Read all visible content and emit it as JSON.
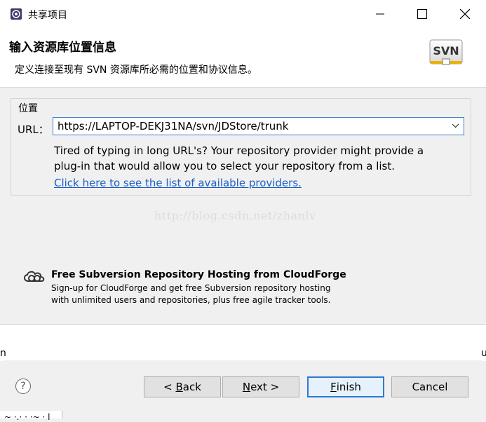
{
  "window": {
    "title": "共享项目"
  },
  "banner": {
    "title": "输入资源库位置信息",
    "description": "定义连接至现有 SVN 资源库所必需的位置和协议信息。",
    "logo_text": "SVN"
  },
  "location": {
    "group_title": "位置",
    "url_label": "URL：",
    "url_value": "https://LAPTOP-DEKJ31NA/svn/JDStore/trunk",
    "hint_line1": "Tired of typing in long URL's?  Your repository provider might provide a",
    "hint_line2": "plug-in that would allow you to select your repository from a list.",
    "providers_link": "Click here to see the list of available providers."
  },
  "watermark": "http://blog.csdn.net/zhanlv",
  "cloudforge": {
    "title": "Free Subversion Repository Hosting from CloudForge",
    "desc_line1": "Sign-up for CloudForge and get free Subversion repository hosting",
    "desc_line2": "with unlimited users and repositories, plus free agile tracker tools."
  },
  "background": {
    "left_char": "n",
    "right_char": "u",
    "bottom_text": "~ ·.· · ·~ · l"
  },
  "buttons": {
    "back_prefix": "< ",
    "back_mnemonic": "B",
    "back_rest": "ack",
    "next_mnemonic": "N",
    "next_rest": "ext >",
    "finish_mnemonic": "F",
    "finish_rest": "inish",
    "cancel": "Cancel"
  },
  "icons": {
    "app": "eclipse-icon",
    "minimize": "minimize-icon",
    "maximize": "maximize-icon",
    "close": "close-icon",
    "combo": "chevron-down-icon",
    "help": "help-icon",
    "cloudforge": "cloudforge-icon"
  }
}
